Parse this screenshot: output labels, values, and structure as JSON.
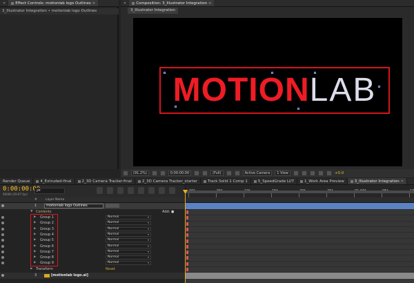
{
  "left_panel": {
    "tabs": [
      {
        "label": "Effect Controls: motionlab logo Outlines"
      }
    ],
    "breadcrumb": "3_Illustrator Integration • motionlab logo Outlines"
  },
  "comp_panel": {
    "tab_label": "Composition: 3_Illustrator Integration",
    "subtab": "3_Illustrator Integration",
    "logo": {
      "motion": "MOTION",
      "lab": "LAB"
    },
    "toolbar": {
      "zoom": "(91.2%)",
      "timecode": "0:00:00:00",
      "resolution": "(Full)",
      "camera": "Active Camera",
      "views": "1 View",
      "exposure": "+0.0"
    }
  },
  "timeline_tabs": [
    "Render Queue",
    "4_Extruded-final",
    "2_3D Camera Tracker-final",
    "2_3D Camera Tracker_starter",
    "Track Solid 1 Comp 1",
    "5_SpeedGrade LUT",
    "1_Work Area Preview",
    "3_Illustrator Integration"
  ],
  "timeline": {
    "timecode": "0:00:00:00",
    "fps": "00000 (29.97 fps)",
    "search_placeholder": "ρ▾",
    "ruler": [
      "00f",
      "05f",
      "10f",
      "15f",
      "20f",
      "25f",
      "01:00f",
      "05f",
      "10f"
    ],
    "header": {
      "num": "#",
      "layer_name": "Layer Name"
    },
    "layer1": {
      "num": "1",
      "name": "motionlab logo Outlines"
    },
    "contents": {
      "label": "Contents",
      "add": "Add: ●"
    },
    "groups": [
      {
        "name": "Group 1",
        "mode": "Normal"
      },
      {
        "name": "Group 2",
        "mode": "Normal"
      },
      {
        "name": "Group 3",
        "mode": "Normal"
      },
      {
        "name": "Group 4",
        "mode": "Normal"
      },
      {
        "name": "Group 5",
        "mode": "Normal"
      },
      {
        "name": "Group 6",
        "mode": "Normal"
      },
      {
        "name": "Group 7",
        "mode": "Normal"
      },
      {
        "name": "Group 8",
        "mode": "Normal"
      },
      {
        "name": "Group 9",
        "mode": "Normal"
      }
    ],
    "transform": {
      "label": "Transform",
      "reset": "Reset"
    },
    "layer3": {
      "num": "3",
      "name": "[motionlab logo.ai]"
    }
  }
}
